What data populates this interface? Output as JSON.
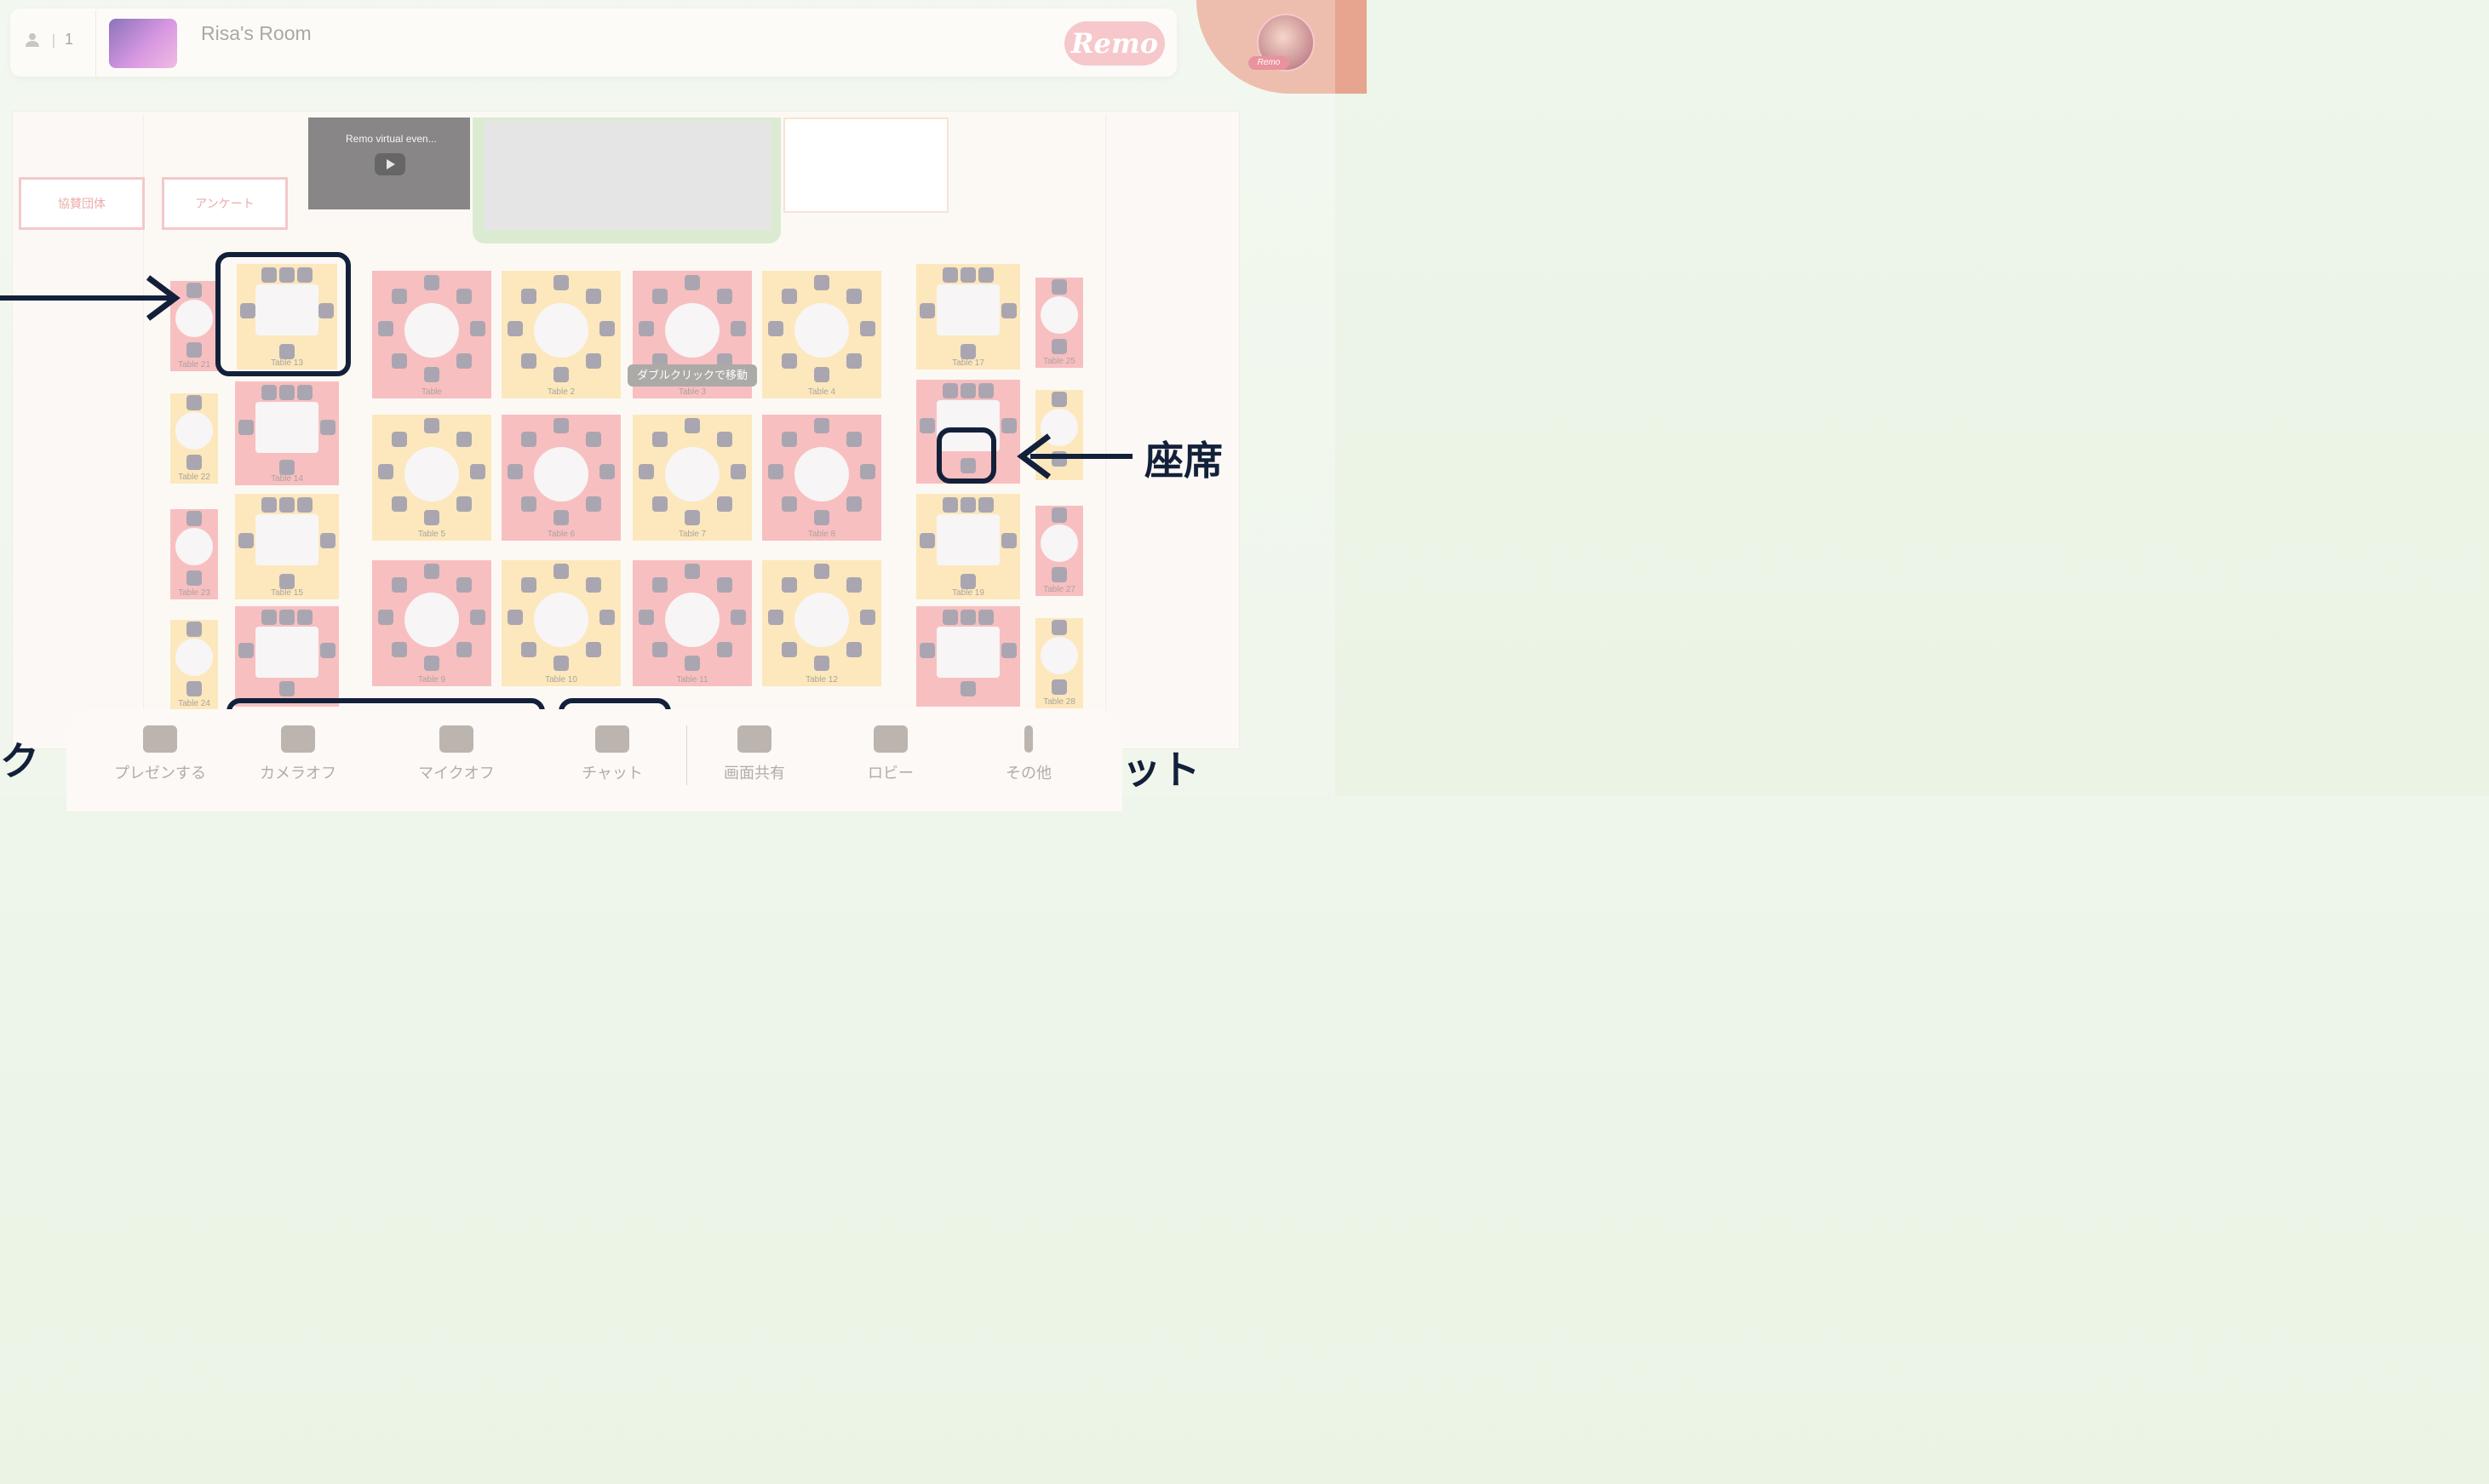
{
  "header": {
    "participant_count": "1",
    "room_name": "Risa's Room",
    "logo_text": "Remo",
    "avatar_tag": "Remo"
  },
  "booths": {
    "sponsor": "協賛団体",
    "survey": "アンケート"
  },
  "video": {
    "title": "Remo virtual even..."
  },
  "tables": {
    "t1": "Table",
    "t2": "Table 2",
    "t3": "Table 3",
    "t4": "Table 4",
    "t5": "Table 5",
    "t6": "Table 6",
    "t7": "Table 7",
    "t8": "Table 8",
    "t9": "Table 9",
    "t10": "Table 10",
    "t11": "Table 11",
    "t12": "Table 12",
    "t13": "Table 13",
    "t14": "Table 14",
    "t15": "Table 15",
    "t17": "Table 17",
    "t19": "Table 19",
    "t21": "Table 21",
    "t22": "Table 22",
    "t23": "Table 23",
    "t24": "Table 24",
    "t25": "Table 25",
    "t27": "Table 27",
    "t28": "Table 28"
  },
  "tooltip": "ダブルクリックで移動",
  "annotations": {
    "seat": "座席",
    "chat": "チャット",
    "left_partial": "ク"
  },
  "toolbar": {
    "present": "プレゼンする",
    "camera": "カメラオフ",
    "mic": "マイクオフ",
    "chat": "チャット",
    "share": "画面共有",
    "people": "ロビー",
    "more": "その他"
  },
  "colors": {
    "annotation": "#13203a",
    "red_table": "#f6a7a8",
    "yellow_table": "#fbe0a2"
  }
}
